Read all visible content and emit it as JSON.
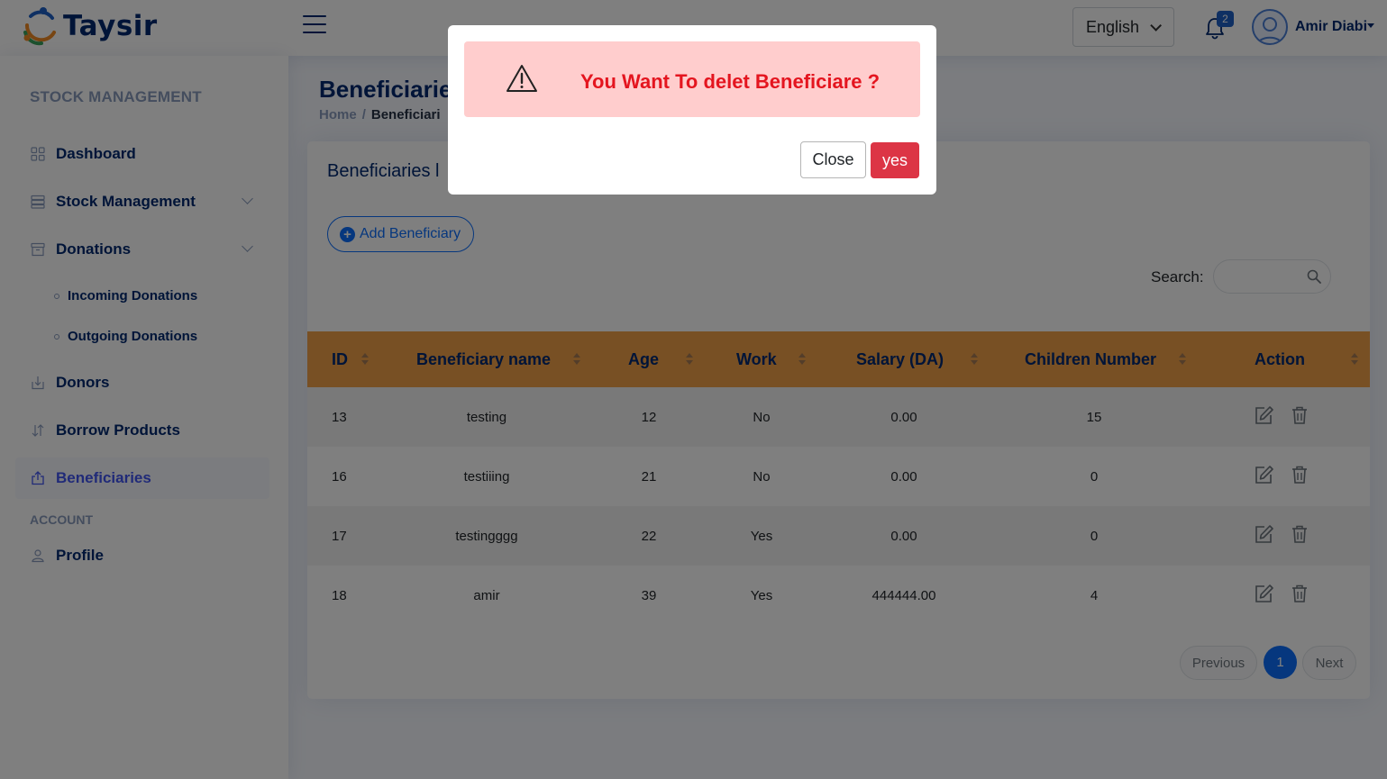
{
  "header": {
    "brand": "Taysir",
    "language": "English",
    "notifications_count": "2",
    "user_name": "Amir Diabi"
  },
  "sidebar": {
    "heading": "STOCK MANAGEMENT",
    "items": [
      {
        "label": "Dashboard",
        "icon": "grid-icon"
      },
      {
        "label": "Stock Management",
        "icon": "server-icon"
      },
      {
        "label": "Donations",
        "icon": "archive-icon"
      },
      {
        "label": "Donors",
        "icon": "download-box-icon"
      },
      {
        "label": "Borrow Products",
        "icon": "arrows-updown-icon"
      },
      {
        "label": "Beneficiaries",
        "icon": "share-box-icon"
      }
    ],
    "subitems": [
      "Incoming Donations",
      "Outgoing Donations"
    ],
    "account_heading": "ACCOUNT",
    "profile_label": "Profile"
  },
  "page": {
    "title": "Beneficiarie",
    "breadcrumb_home": "Home",
    "breadcrumb_sep": "/",
    "breadcrumb_current": "Beneficiari",
    "card_title": "Beneficiaries l",
    "add_button": "Add Beneficiary",
    "search_label": "Search:"
  },
  "table": {
    "headers": [
      "ID",
      "Beneficiary name",
      "Age",
      "Work",
      "Salary (DA)",
      "Children Number",
      "Action"
    ],
    "rows": [
      {
        "id": "13",
        "name": "testing",
        "age": "12",
        "work": "No",
        "salary": "0.00",
        "children": "15"
      },
      {
        "id": "16",
        "name": "testiiing",
        "age": "21",
        "work": "No",
        "salary": "0.00",
        "children": "0"
      },
      {
        "id": "17",
        "name": "testingggg",
        "age": "22",
        "work": "Yes",
        "salary": "0.00",
        "children": "0"
      },
      {
        "id": "18",
        "name": "amir",
        "age": "39",
        "work": "Yes",
        "salary": "444444.00",
        "children": "4"
      }
    ]
  },
  "pagination": {
    "previous": "Previous",
    "current": "1",
    "next": "Next"
  },
  "modal": {
    "message": "You Want To delet Beneficiare ?",
    "close_label": "Close",
    "yes_label": "yes"
  },
  "colors": {
    "table_header": "#f0a049",
    "alert_bg": "#ffcdcd",
    "alert_text": "#e4151f",
    "danger": "#dc3545",
    "primary": "#0d6efd",
    "navy": "#012970"
  }
}
